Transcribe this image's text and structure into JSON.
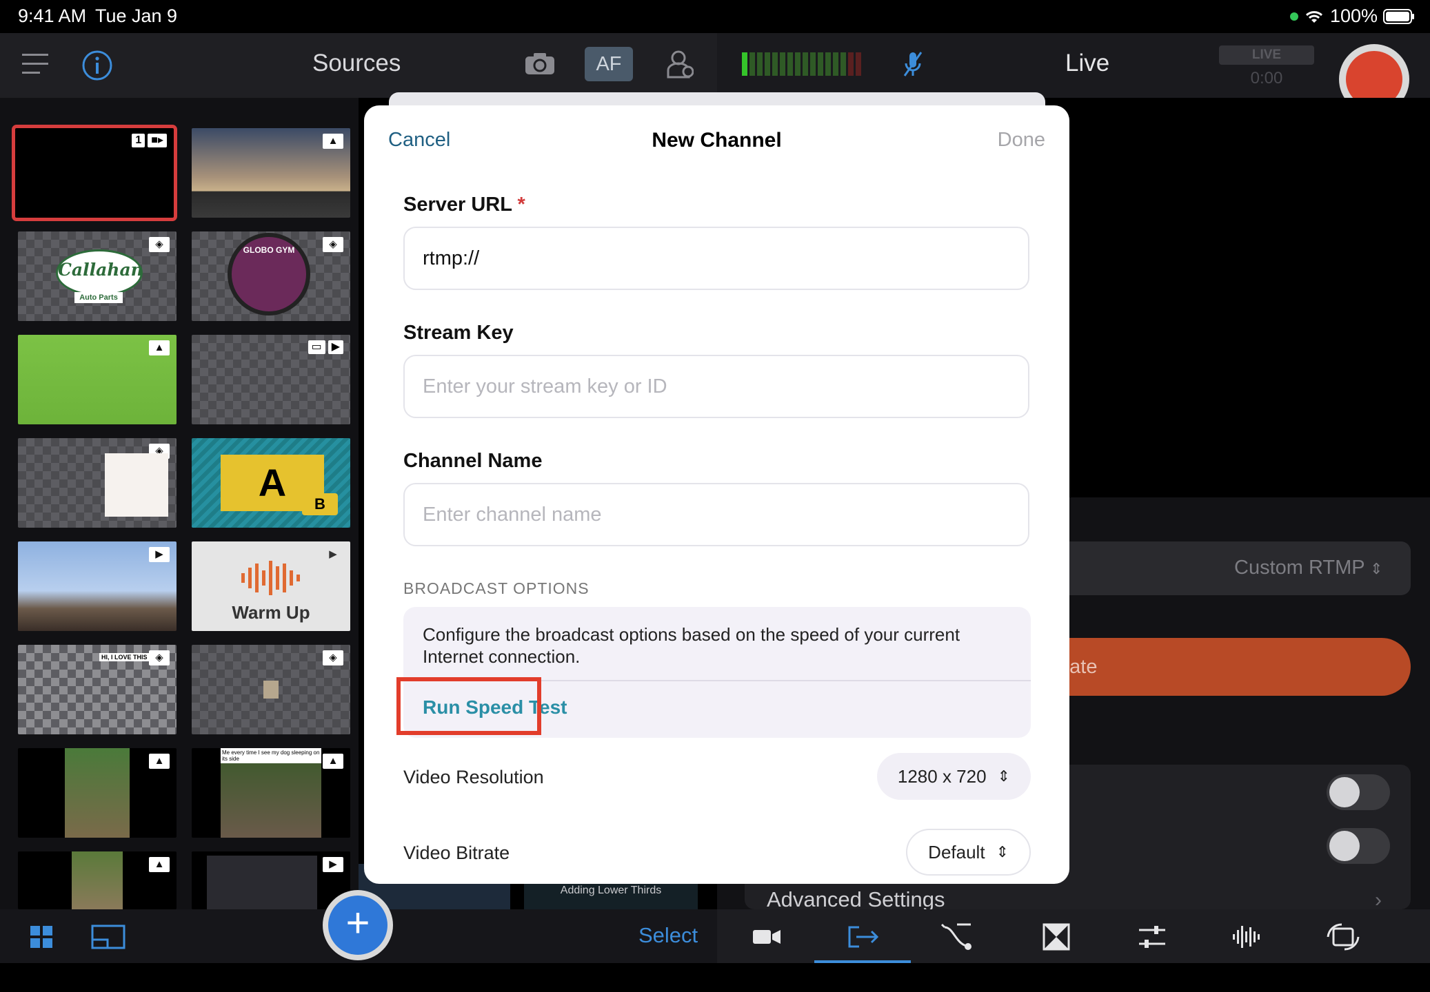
{
  "status": {
    "time": "9:41 AM",
    "date": "Tue Jan 9",
    "battery": "100%"
  },
  "header": {
    "sources_title": "Sources",
    "af_label": "AF",
    "live_title": "Live",
    "live_badge": "LIVE",
    "live_timer": "0:00"
  },
  "sources": {
    "tiles": [
      {
        "kind": "camera",
        "badge": "1"
      },
      {
        "kind": "image"
      },
      {
        "kind": "overlay",
        "label": "Callahan",
        "sublabel": "Auto Parts"
      },
      {
        "kind": "overlay",
        "label": "GLOBO GYM"
      },
      {
        "kind": "image"
      },
      {
        "kind": "video"
      },
      {
        "kind": "overlay"
      },
      {
        "kind": "overlay",
        "label": "A",
        "sublabel": "B"
      },
      {
        "kind": "video"
      },
      {
        "kind": "video",
        "label": "Warm Up"
      },
      {
        "kind": "overlay",
        "label": "HI, I LOVE THIS"
      },
      {
        "kind": "overlay"
      },
      {
        "kind": "image"
      },
      {
        "kind": "image",
        "label": "Me every time I see my dog sleeping on its side"
      },
      {
        "kind": "image"
      },
      {
        "kind": "video"
      }
    ]
  },
  "bottom": {
    "select_label": "Select",
    "add_label": "+"
  },
  "behind": {
    "service_value": "Custom RTMP",
    "create_label": "eate",
    "advanced_label": "Advanced Settings",
    "mini_label": "Adding Lower Thirds"
  },
  "modal": {
    "cancel": "Cancel",
    "title": "New Channel",
    "done": "Done",
    "server_url": {
      "label": "Server URL",
      "required": "*",
      "value": "rtmp://"
    },
    "stream_key": {
      "label": "Stream Key",
      "placeholder": "Enter your stream key or ID"
    },
    "channel_name": {
      "label": "Channel Name",
      "placeholder": "Enter channel name"
    },
    "broadcast": {
      "header": "BROADCAST OPTIONS",
      "description": "Configure the broadcast options based on the speed of your current Internet connection.",
      "speed_test": "Run Speed Test"
    },
    "video_resolution": {
      "label": "Video Resolution",
      "value": "1280 x 720"
    },
    "video_bitrate": {
      "label": "Video Bitrate",
      "value": "Default"
    }
  },
  "colors": {
    "accent": "#3c8ddb",
    "record": "#d9442e",
    "highlight": "#e23d2b",
    "link": "#2a8fa6"
  }
}
